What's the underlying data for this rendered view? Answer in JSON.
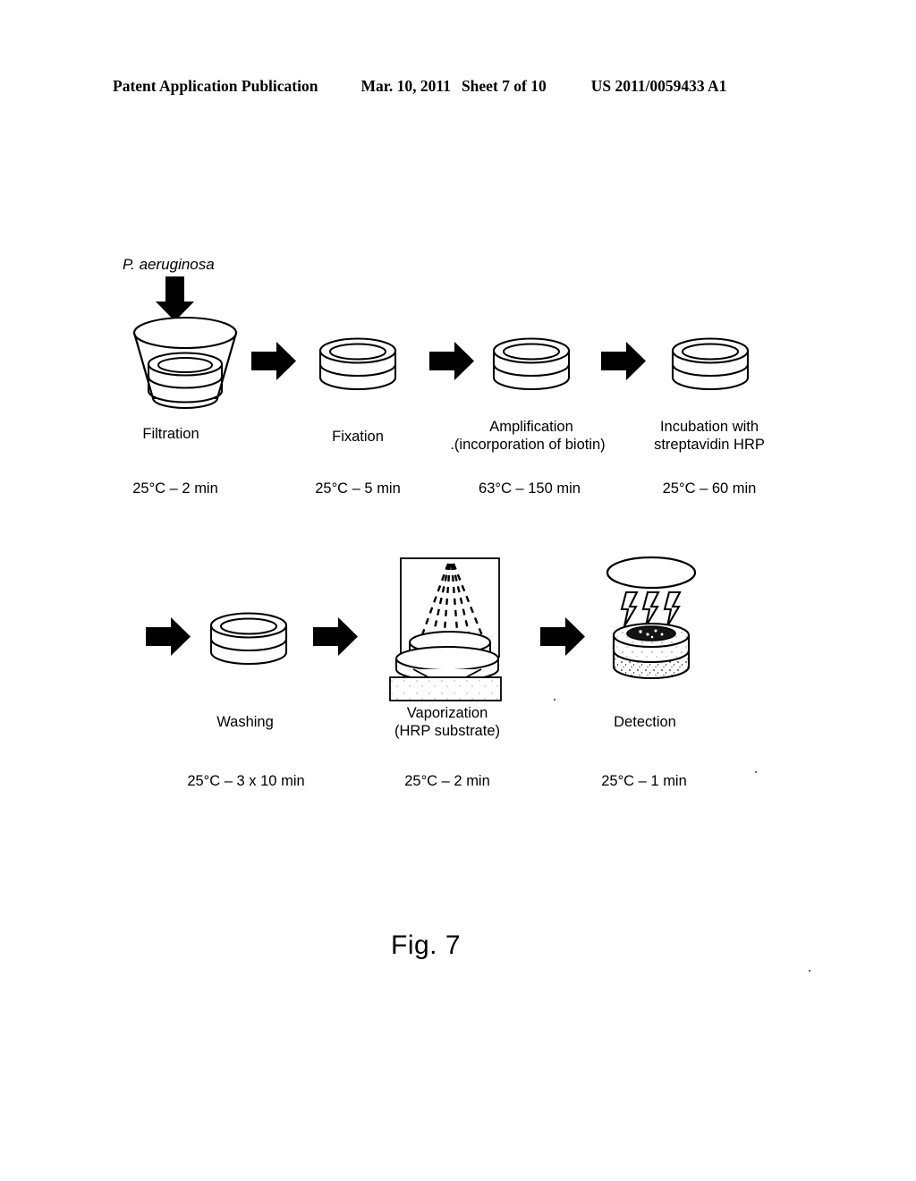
{
  "header": {
    "publication": "Patent Application Publication",
    "date": "Mar. 10, 2011",
    "sheet": "Sheet 7 of 10",
    "number": "US 2011/0059433 A1"
  },
  "figure": {
    "caption": "Fig. 7",
    "sample_label": "P. aeruginosa",
    "colors": {
      "ink": "#000000",
      "background": "#ffffff"
    },
    "row1": [
      {
        "id": "filtration",
        "icon": "funnel-filter-holder-icon",
        "name": "Filtration",
        "name_line2": "",
        "condition": "25°C – 2 min"
      },
      {
        "id": "fixation",
        "icon": "filter-disc-icon",
        "name": "Fixation",
        "name_line2": "",
        "condition": "25°C – 5 min"
      },
      {
        "id": "amplification",
        "icon": "filter-disc-icon",
        "name": "Amplification",
        "name_line2": ".(incorporation of biotin)",
        "condition": "63°C – 150 min"
      },
      {
        "id": "incubation",
        "icon": "filter-disc-icon",
        "name": "Incubation with",
        "name_line2": "streptavidin HRP",
        "condition": "25°C – 60 min"
      }
    ],
    "row2": [
      {
        "id": "washing",
        "icon": "filter-disc-icon",
        "name": "Washing",
        "name_line2": "",
        "condition": "25°C – 3 x 10 min"
      },
      {
        "id": "vaporization",
        "icon": "spray-chamber-icon",
        "name": "Vaporization",
        "name_line2": "(HRP substrate)",
        "condition": "25°C – 2 min"
      },
      {
        "id": "detection",
        "icon": "luminescence-detector-icon",
        "name": "Detection",
        "name_line2": "",
        "condition": "25°C – 1 min"
      }
    ]
  }
}
